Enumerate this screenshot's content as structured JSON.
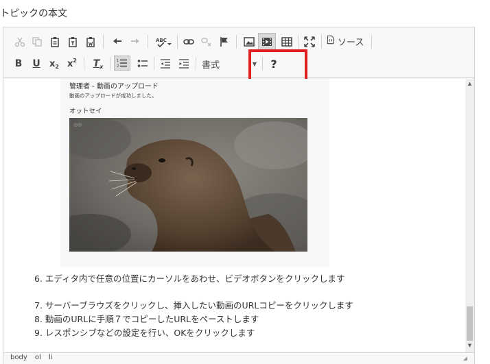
{
  "page": {
    "field_label": "トピックの本文"
  },
  "toolbar": {
    "source_label": "ソース",
    "format_label": "書式",
    "help_label": "?",
    "bold_label": "B",
    "underline_label": "U",
    "subscript_label": "x",
    "superscript_label": "x",
    "remove_format_label": "T"
  },
  "content": {
    "embed": {
      "title": "管理者 - 動画のアップロード",
      "message": "動画のアップロードが成功しました。",
      "name": "オットセイ"
    },
    "steps": [
      "6. エディタ内で任意の位置にカーソルをあわせ、ビデオボタンをクリックします",
      "7. サーバーブラウズをクリックし、挿入したい動画のURLコピーをクリックします",
      "8. 動画のURLに手順７でコピーしたURLをペーストします",
      "9. レスポンシブなどの設定を行い、OKをクリックします"
    ]
  },
  "pathbar": [
    "body",
    "ol",
    "li"
  ],
  "colors": {
    "highlight": "#e02020",
    "toolbar_bg": "#f8f8f8",
    "border": "#d1d1d1"
  }
}
